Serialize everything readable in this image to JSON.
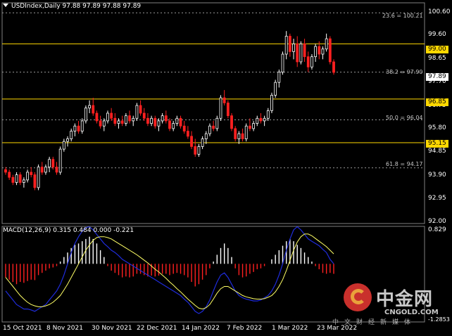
{
  "header": {
    "symbol_line": "USDIndex,Daily  97.88 97.89 97.88 97.89"
  },
  "macd_header": "MACD(12,26,9) 0.315 0.484 0.000 -0.221",
  "colors": {
    "background": "#000000",
    "bull_candle": "#ffffff",
    "bear_candle": "#ff2020",
    "level_line": "#ffd800",
    "macd_line": "#1f2cdc",
    "signal_line": "#ffff66",
    "macd_hist_pos": "#ffffff",
    "macd_hist_neg": "#ff2020"
  },
  "price_axis": [
    "100.60",
    "99.60",
    "98.65",
    "97.70",
    "96.75",
    "95.80",
    "94.85",
    "93.90",
    "92.95",
    "92.00"
  ],
  "macd_axis": {
    "top": "0.829",
    "bottom": "-1.2853"
  },
  "time_axis": [
    "15 Oct 2021",
    "8 Nov 2021",
    "30 Nov 2021",
    "22 Dec 2021",
    "14 Jan 2022",
    "7 Feb 2022",
    "1 Mar 2022",
    "23 Mar 2022"
  ],
  "price_tags": {
    "level_99": "99.00",
    "current": "97.89",
    "level_9685": "96.85",
    "level_9515": "95.15"
  },
  "fibo_labels": {
    "f236": "23.6 = 100.21",
    "f382": "38.2 = 97.90",
    "f500": "50.0 = 96.04",
    "f618": "61.8 = 94.17"
  },
  "watermark": {
    "cn": "中金网",
    "en": "CNGOLD.COM",
    "sub": "中文财经新媒体"
  },
  "icons": {
    "dropdown": "triangle-down-icon",
    "logo": "cngold-logo-icon"
  },
  "chart_data": {
    "type": "candlestick",
    "title": "USDIndex,Daily",
    "ylim": [
      92.0,
      100.6
    ],
    "candles": [
      [
        94.1,
        94.2,
        93.9,
        94.0
      ],
      [
        94.0,
        94.1,
        93.7,
        93.8
      ],
      [
        93.8,
        93.9,
        93.5,
        93.6
      ],
      [
        93.6,
        94.0,
        93.5,
        93.9
      ],
      [
        93.9,
        94.0,
        93.5,
        93.6
      ],
      [
        93.6,
        93.8,
        93.4,
        93.7
      ],
      [
        93.7,
        94.1,
        93.6,
        94.0
      ],
      [
        94.0,
        94.2,
        93.8,
        93.9
      ],
      [
        93.9,
        94.0,
        93.3,
        93.4
      ],
      [
        93.4,
        94.3,
        93.3,
        94.2
      ],
      [
        94.2,
        94.4,
        93.9,
        94.0
      ],
      [
        94.0,
        94.3,
        93.9,
        94.2
      ],
      [
        94.2,
        94.6,
        94.0,
        94.5
      ],
      [
        94.5,
        94.6,
        94.1,
        94.2
      ],
      [
        94.2,
        94.4,
        93.9,
        94.0
      ],
      [
        94.0,
        95.0,
        93.9,
        94.9
      ],
      [
        94.9,
        95.3,
        94.8,
        95.2
      ],
      [
        95.2,
        95.4,
        95.0,
        95.3
      ],
      [
        95.3,
        95.7,
        95.2,
        95.6
      ],
      [
        95.6,
        95.9,
        95.4,
        95.8
      ],
      [
        95.8,
        96.0,
        95.5,
        95.6
      ],
      [
        95.6,
        96.1,
        95.5,
        96.0
      ],
      [
        96.0,
        96.6,
        95.9,
        96.5
      ],
      [
        96.5,
        96.8,
        96.3,
        96.6
      ],
      [
        96.6,
        96.9,
        96.2,
        96.3
      ],
      [
        96.3,
        96.4,
        95.9,
        96.0
      ],
      [
        96.0,
        96.2,
        95.7,
        95.8
      ],
      [
        95.8,
        96.1,
        95.6,
        96.0
      ],
      [
        96.0,
        96.4,
        95.9,
        96.3
      ],
      [
        96.3,
        96.5,
        96.0,
        96.1
      ],
      [
        96.1,
        96.3,
        95.8,
        95.9
      ],
      [
        95.9,
        96.1,
        95.7,
        96.0
      ],
      [
        96.0,
        96.2,
        95.8,
        95.9
      ],
      [
        95.9,
        96.3,
        95.8,
        96.2
      ],
      [
        96.2,
        96.4,
        95.9,
        96.0
      ],
      [
        96.0,
        96.2,
        95.8,
        96.1
      ],
      [
        96.1,
        96.7,
        96.0,
        96.6
      ],
      [
        96.6,
        96.8,
        96.2,
        96.3
      ],
      [
        96.3,
        96.5,
        96.0,
        96.1
      ],
      [
        96.1,
        96.3,
        95.8,
        95.9
      ],
      [
        95.9,
        96.2,
        95.8,
        96.1
      ],
      [
        96.1,
        96.2,
        95.7,
        95.8
      ],
      [
        95.8,
        96.1,
        95.6,
        96.0
      ],
      [
        96.0,
        96.3,
        95.9,
        96.2
      ],
      [
        96.2,
        96.4,
        95.9,
        96.0
      ],
      [
        96.0,
        96.1,
        95.6,
        95.7
      ],
      [
        95.7,
        96.0,
        95.6,
        95.9
      ],
      [
        95.9,
        96.2,
        95.8,
        96.1
      ],
      [
        96.1,
        96.2,
        95.7,
        95.8
      ],
      [
        95.8,
        96.0,
        95.5,
        95.6
      ],
      [
        95.6,
        95.8,
        95.3,
        95.4
      ],
      [
        95.4,
        95.6,
        94.9,
        95.0
      ],
      [
        95.0,
        95.3,
        94.6,
        94.7
      ],
      [
        94.7,
        95.1,
        94.6,
        95.0
      ],
      [
        95.0,
        95.4,
        94.9,
        95.3
      ],
      [
        95.3,
        95.6,
        95.1,
        95.5
      ],
      [
        95.5,
        95.9,
        95.4,
        95.8
      ],
      [
        95.8,
        96.0,
        95.6,
        95.7
      ],
      [
        95.7,
        96.2,
        95.6,
        96.1
      ],
      [
        96.1,
        97.0,
        96.0,
        96.9
      ],
      [
        96.9,
        97.2,
        96.6,
        96.7
      ],
      [
        96.7,
        96.8,
        96.1,
        96.2
      ],
      [
        96.2,
        96.3,
        95.6,
        95.7
      ],
      [
        95.7,
        95.8,
        95.2,
        95.3
      ],
      [
        95.3,
        95.6,
        95.1,
        95.5
      ],
      [
        95.5,
        95.7,
        95.2,
        95.3
      ],
      [
        95.3,
        95.9,
        95.2,
        95.8
      ],
      [
        95.8,
        96.1,
        95.6,
        95.7
      ],
      [
        95.7,
        96.0,
        95.6,
        95.9
      ],
      [
        95.9,
        96.2,
        95.8,
        96.1
      ],
      [
        96.1,
        96.3,
        95.9,
        96.0
      ],
      [
        96.0,
        96.2,
        95.8,
        96.1
      ],
      [
        96.1,
        96.5,
        96.0,
        96.4
      ],
      [
        96.4,
        97.1,
        96.3,
        97.0
      ],
      [
        97.0,
        97.6,
        96.9,
        97.5
      ],
      [
        97.5,
        98.0,
        97.3,
        97.9
      ],
      [
        97.9,
        98.7,
        97.8,
        98.6
      ],
      [
        98.6,
        99.5,
        98.4,
        99.3
      ],
      [
        99.3,
        99.4,
        98.5,
        98.7
      ],
      [
        98.7,
        99.2,
        98.4,
        99.0
      ],
      [
        99.0,
        99.3,
        98.1,
        98.3
      ],
      [
        98.3,
        99.1,
        98.2,
        99.0
      ],
      [
        99.0,
        99.2,
        98.3,
        98.5
      ],
      [
        98.5,
        98.7,
        97.9,
        98.1
      ],
      [
        98.1,
        98.6,
        98.0,
        98.5
      ],
      [
        98.5,
        99.0,
        98.3,
        98.9
      ],
      [
        98.9,
        99.1,
        98.4,
        98.6
      ],
      [
        98.6,
        98.9,
        98.4,
        98.8
      ],
      [
        98.8,
        99.4,
        98.7,
        99.2
      ],
      [
        99.2,
        99.3,
        98.2,
        98.3
      ],
      [
        98.3,
        98.4,
        97.8,
        97.89
      ]
    ],
    "macd_hist": [
      -0.3,
      -0.35,
      -0.4,
      -0.45,
      -0.4,
      -0.42,
      -0.38,
      -0.35,
      -0.36,
      -0.25,
      -0.2,
      -0.15,
      -0.1,
      -0.08,
      -0.05,
      0.05,
      0.15,
      0.25,
      0.35,
      0.42,
      0.45,
      0.5,
      0.55,
      0.6,
      0.55,
      0.45,
      0.3,
      0.15,
      -0.05,
      -0.15,
      -0.2,
      -0.25,
      -0.3,
      -0.28,
      -0.3,
      -0.28,
      -0.22,
      -0.22,
      -0.25,
      -0.28,
      -0.26,
      -0.28,
      -0.26,
      -0.22,
      -0.22,
      -0.25,
      -0.22,
      -0.2,
      -0.22,
      -0.25,
      -0.3,
      -0.4,
      -0.5,
      -0.45,
      -0.35,
      -0.25,
      -0.1,
      0.05,
      0.2,
      0.35,
      0.45,
      0.35,
      0.15,
      -0.1,
      -0.25,
      -0.3,
      -0.28,
      -0.22,
      -0.18,
      -0.12,
      -0.1,
      -0.05,
      0.0,
      0.1,
      0.2,
      0.3,
      0.4,
      0.5,
      0.55,
      0.5,
      0.42,
      0.35,
      0.25,
      0.15,
      0.05,
      -0.05,
      -0.12,
      -0.2,
      -0.22,
      -0.2,
      -0.221
    ],
    "macd_line": [
      -0.6,
      -0.7,
      -0.8,
      -0.9,
      -0.95,
      -1.0,
      -1.0,
      -1.02,
      -1.05,
      -1.0,
      -0.95,
      -0.9,
      -0.8,
      -0.7,
      -0.6,
      -0.45,
      -0.25,
      0.0,
      0.25,
      0.45,
      0.6,
      0.72,
      0.8,
      0.82,
      0.75,
      0.65,
      0.55,
      0.45,
      0.38,
      0.3,
      0.25,
      0.18,
      0.1,
      0.05,
      0.0,
      -0.05,
      -0.1,
      -0.15,
      -0.2,
      -0.25,
      -0.3,
      -0.35,
      -0.4,
      -0.45,
      -0.5,
      -0.55,
      -0.6,
      -0.65,
      -0.7,
      -0.78,
      -0.85,
      -0.95,
      -1.05,
      -1.1,
      -1.05,
      -0.95,
      -0.8,
      -0.6,
      -0.4,
      -0.25,
      -0.2,
      -0.3,
      -0.45,
      -0.6,
      -0.7,
      -0.75,
      -0.78,
      -0.8,
      -0.82,
      -0.82,
      -0.8,
      -0.75,
      -0.7,
      -0.6,
      -0.45,
      -0.25,
      0.0,
      0.3,
      0.55,
      0.75,
      0.82,
      0.75,
      0.65,
      0.55,
      0.5,
      0.45,
      0.4,
      0.32,
      0.25,
      0.1,
      0.0
    ],
    "signal_line": [
      -0.3,
      -0.4,
      -0.5,
      -0.6,
      -0.7,
      -0.78,
      -0.85,
      -0.9,
      -0.93,
      -0.95,
      -0.95,
      -0.93,
      -0.9,
      -0.85,
      -0.78,
      -0.7,
      -0.58,
      -0.45,
      -0.3,
      -0.15,
      0.0,
      0.15,
      0.3,
      0.42,
      0.52,
      0.58,
      0.6,
      0.6,
      0.58,
      0.55,
      0.5,
      0.45,
      0.4,
      0.35,
      0.3,
      0.25,
      0.2,
      0.14,
      0.08,
      0.02,
      -0.05,
      -0.12,
      -0.18,
      -0.25,
      -0.32,
      -0.4,
      -0.47,
      -0.55,
      -0.62,
      -0.7,
      -0.78,
      -0.85,
      -0.92,
      -0.98,
      -1.0,
      -0.97,
      -0.9,
      -0.78,
      -0.65,
      -0.55,
      -0.5,
      -0.5,
      -0.55,
      -0.6,
      -0.65,
      -0.7,
      -0.73,
      -0.75,
      -0.77,
      -0.78,
      -0.78,
      -0.77,
      -0.74,
      -0.7,
      -0.62,
      -0.5,
      -0.35,
      -0.15,
      0.08,
      0.3,
      0.48,
      0.6,
      0.66,
      0.66,
      0.62,
      0.56,
      0.5,
      0.44,
      0.38,
      0.3,
      0.221
    ]
  }
}
